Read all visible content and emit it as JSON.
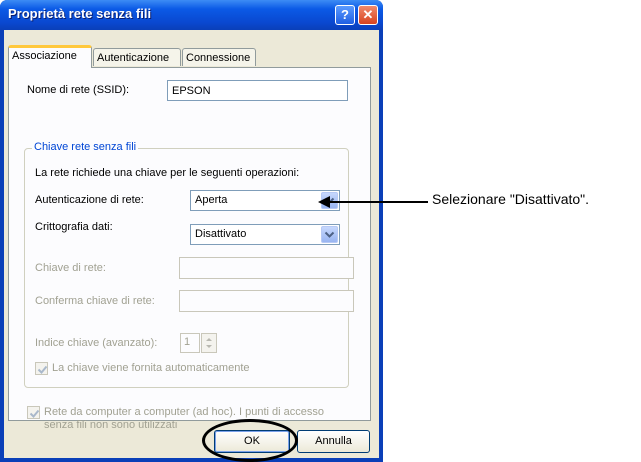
{
  "window": {
    "title": "Proprietà rete senza fili",
    "help_label": "?",
    "close_label": "✕"
  },
  "tabs": [
    {
      "label": "Associazione",
      "active": true
    },
    {
      "label": "Autenticazione",
      "active": false
    },
    {
      "label": "Connessione",
      "active": false
    }
  ],
  "ssid": {
    "label": "Nome di rete (SSID):",
    "value": "EPSON"
  },
  "key_group": {
    "title": "Chiave rete senza fili",
    "description": "La rete richiede una chiave per le seguenti operazioni:",
    "auth": {
      "label": "Autenticazione di rete:",
      "value": "Aperta"
    },
    "encryption": {
      "label": "Crittografia dati:",
      "value": "Disattivato"
    },
    "network_key": {
      "label": "Chiave di rete:",
      "value": ""
    },
    "confirm_key": {
      "label": "Conferma chiave di rete:",
      "value": ""
    },
    "key_index": {
      "label": "Indice chiave (avanzato):",
      "value": "1"
    },
    "auto_key": {
      "label": "La chiave viene fornita automaticamente",
      "checked": true
    }
  },
  "adhoc": {
    "label_line1": "Rete da computer a computer (ad hoc). I punti di accesso",
    "label_line2": "senza fili non sono utilizzati",
    "checked": true
  },
  "buttons": {
    "ok": "OK",
    "cancel": "Annulla"
  },
  "annotation": {
    "text": "Selezionare \"Disattivato\"."
  },
  "icons": [
    "help-icon",
    "close-icon",
    "chevron-down-icon",
    "checkmark-icon",
    "spin-up-icon",
    "spin-down-icon",
    "arrow-left-icon"
  ]
}
